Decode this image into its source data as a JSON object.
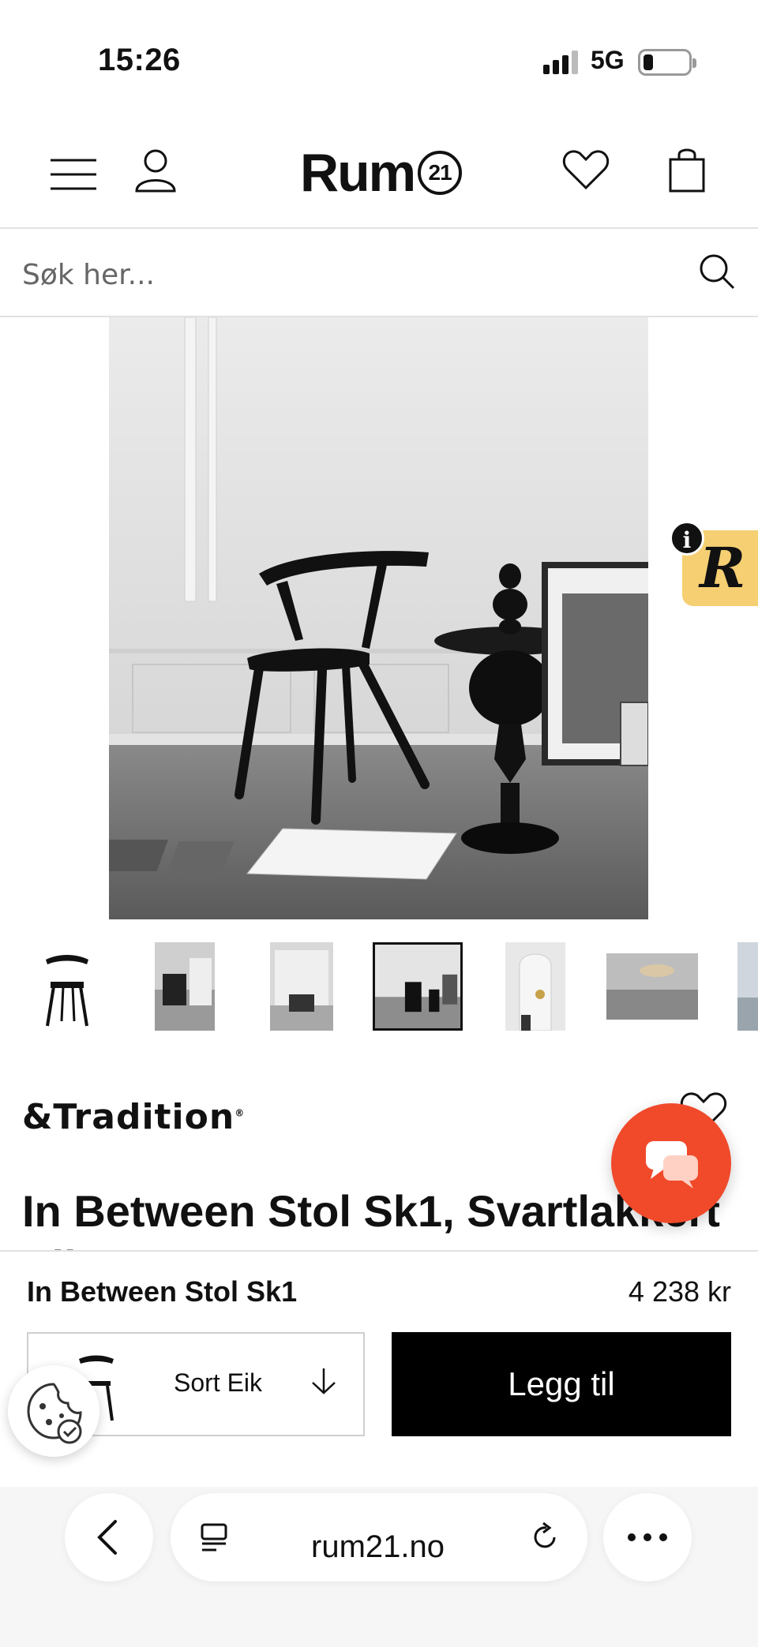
{
  "status_bar": {
    "time": "15:26",
    "network": "5G"
  },
  "header": {
    "logo_text": "Rum",
    "logo_badge": "21"
  },
  "search": {
    "placeholder": "Søk her..."
  },
  "hero": {
    "alt": ""
  },
  "promo_badge": {
    "letter": "R",
    "info_icon": "i"
  },
  "thumbnails": {
    "count": 7,
    "selected_index": 3
  },
  "product": {
    "brand": "&Tradition",
    "brand_mark": "®",
    "title": "In Between Stol Sk1, Svartlakkert",
    "title_overflow": "Eik"
  },
  "buy_bar": {
    "name": "In Between Stol Sk1",
    "price": "4 238 kr",
    "variant": "Sort Eik",
    "add_label": "Legg til"
  },
  "browser": {
    "url": "rum21.no"
  },
  "colors": {
    "accent_chat": "#f04a2b",
    "badge": "#f5cf72"
  }
}
